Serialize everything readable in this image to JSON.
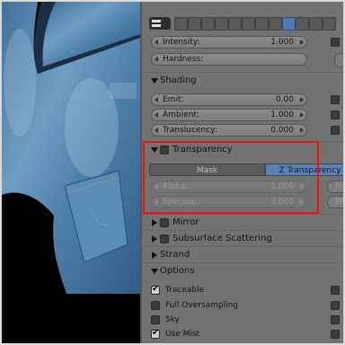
{
  "properties": {
    "intensity": {
      "label": "Intensity:",
      "value": "1.000"
    },
    "hardness": {
      "label": "Hardness:"
    },
    "shading": {
      "title": "Shading",
      "emit": {
        "label": "Emit:",
        "value": "0.00"
      },
      "ambient": {
        "label": "Ambient:",
        "value": "1.000"
      },
      "translucency": {
        "label": "Translucency:",
        "value": "0.000"
      }
    },
    "transparency": {
      "title": "Transparency",
      "enabled": false,
      "tabs": [
        {
          "label": "Mask",
          "active": false
        },
        {
          "label": "Z Transparency",
          "active": true
        }
      ],
      "alpha": {
        "label": "Alpha:",
        "value": "1.000"
      },
      "specular": {
        "label": "Specular:",
        "value": "0.000"
      },
      "right_fr": "Fr",
      "right_bl": "Bl"
    },
    "collapsed_sections": [
      {
        "title": "Mirror",
        "checkbox": true
      },
      {
        "title": "Subsurface Scattering",
        "checkbox": true
      },
      {
        "title": "Strand",
        "checkbox": false
      }
    ],
    "options": {
      "title": "Options",
      "items": [
        {
          "label": "Traceable",
          "checked": true
        },
        {
          "label": "Full Oversampling",
          "checked": false
        },
        {
          "label": "Sky",
          "checked": false
        },
        {
          "label": "Use Mist",
          "checked": true
        }
      ]
    }
  },
  "colors": {
    "panel_bg": "#727272",
    "highlight_box": "#e11111",
    "active_tab": "#5a82b8",
    "active_context_icon": "#4d78b0"
  },
  "toolbar": {
    "icons": [
      "render-icon",
      "render-layers-icon",
      "scene-icon",
      "world-icon",
      "object-icon",
      "constraints-icon",
      "modifiers-icon",
      "data-icon",
      "material-icon",
      "texture-icon",
      "particles-icon",
      "physics-icon"
    ],
    "active": "material-icon"
  }
}
